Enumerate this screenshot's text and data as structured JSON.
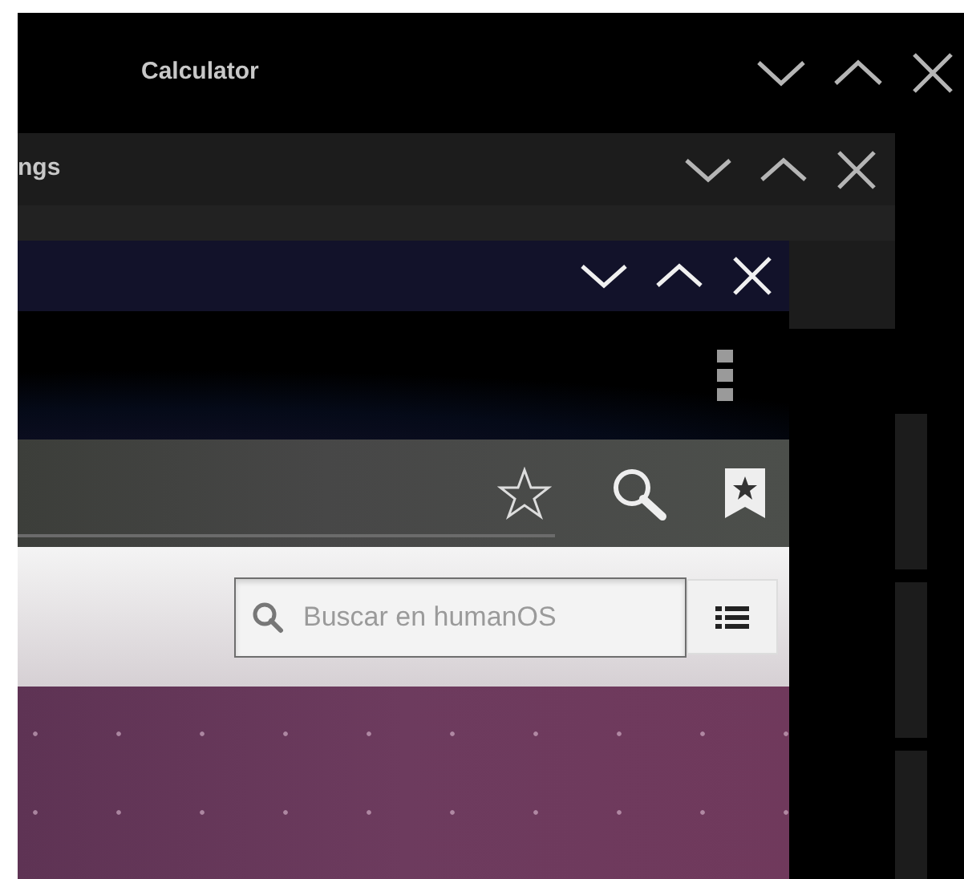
{
  "windows": [
    {
      "kind": "calculator",
      "title": "Calculator"
    },
    {
      "kind": "settings",
      "title": "ngs"
    },
    {
      "kind": "browser"
    }
  ],
  "browser": {
    "search": {
      "placeholder": "Buscar en humanOS"
    }
  }
}
